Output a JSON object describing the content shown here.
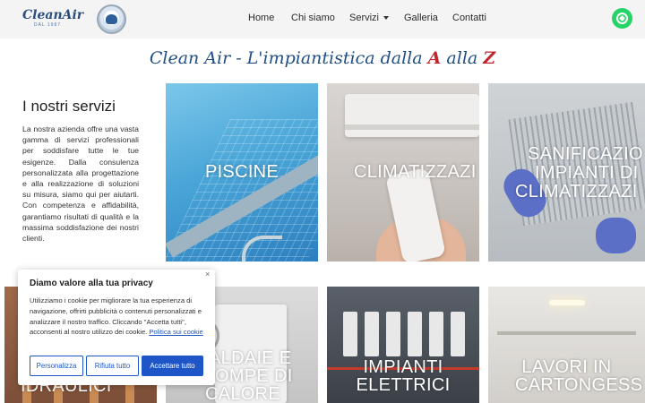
{
  "header": {
    "logo_text": "CleanAir",
    "logo_sub": "DAL 1987",
    "nav": [
      {
        "label": "Home"
      },
      {
        "label": "Chi siamo"
      },
      {
        "label": "Servizi"
      },
      {
        "label": "Galleria"
      },
      {
        "label": "Contatti"
      }
    ],
    "whatsapp_icon": "whatsapp-icon",
    "whatsapp_color": "#25d366"
  },
  "tagline": {
    "prefix": "Clean Air - L'impiantistica dalla ",
    "letter_a": "A",
    "middle": " alla ",
    "letter_z": "Z",
    "accent_color": "#c0262c",
    "color": "#1f4e86"
  },
  "intro": {
    "title": "I nostri servizi",
    "text": "La nostra azienda offre una vasta gamma di servizi professionali per soddisfare tutte le tue esigenze. Dalla consulenza personalizzata alla progettazione e alla realizzazione di soluzioni su misura, siamo qui per aiutarti. Con competenza e affidabilità, garantiamo risultati di qualità e la massima soddisfazione dei nostri clienti."
  },
  "services": {
    "piscine": {
      "line1": "PISCINE"
    },
    "clima": {
      "line1": "CLIMATIZZAZI"
    },
    "sanif": {
      "line1": "SANIFICAZIO",
      "line2": "IMPIANTI DI",
      "line3": "CLIMATIZZAZI"
    },
    "idraulici": {
      "line1": "IDRAULICI"
    },
    "caldaie": {
      "line1": "ALDAIE E",
      "line2": "OMPE DI",
      "line3": "CALORE"
    },
    "elettrici": {
      "line1": "IMPIANTI",
      "line2": "ELETTRICI"
    },
    "cartongesso": {
      "line1": "LAVORI IN",
      "line2": "CARTONGESS"
    }
  },
  "cookie": {
    "close": "×",
    "title": "Diamo valore alla tua privacy",
    "text": "Utilizziamo i cookie per migliorare la tua esperienza di navigazione, offrirti pubblicità o contenuti personalizzati e analizzare il nostro traffico. Cliccando \"Accetta tutti\", acconsenti al nostro utilizzo dei cookie. ",
    "link": "Politica sui cookie",
    "btn_customize": "Personalizza",
    "btn_reject": "Rifiuta tutto",
    "btn_accept": "Accettare tutto",
    "button_color": "#1e56c7"
  }
}
